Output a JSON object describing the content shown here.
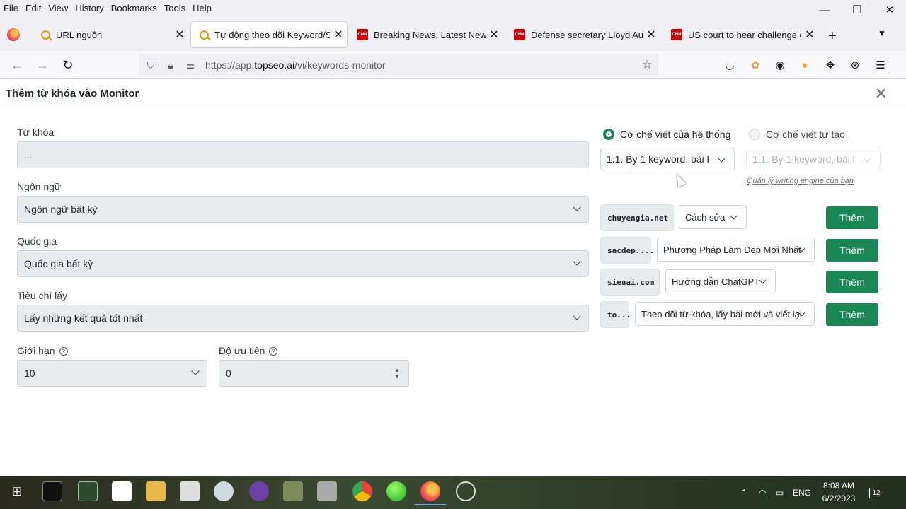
{
  "menu": [
    "File",
    "Edit",
    "View",
    "History",
    "Bookmarks",
    "Tools",
    "Help"
  ],
  "window_controls": {
    "minimize": "—",
    "maximize": "❐",
    "close": "✕"
  },
  "tabs": [
    {
      "title": "URL nguồn",
      "favicon": "search-icon"
    },
    {
      "title": "Tự động theo dõi Keyword/Site",
      "favicon": "search-icon"
    },
    {
      "title": "Breaking News, Latest News and",
      "favicon": "cnn-icon"
    },
    {
      "title": "Defense secretary Lloyd Austin",
      "favicon": "cnn-icon"
    },
    {
      "title": "US court to hear challenge over",
      "favicon": "cnn-icon"
    }
  ],
  "cnn_label": "CNN",
  "newtab": "+",
  "tab_close": "✕",
  "address": {
    "prefix": "https://app.",
    "domain": "topseo.ai",
    "path": "/vi/keywords-monitor"
  },
  "modal": {
    "title": "Thêm từ khóa vào Monitor",
    "close": "✕",
    "keyword_label": "Từ khóa",
    "keyword_placeholder": "...",
    "language_label": "Ngôn ngữ",
    "language_value": "Ngôn ngữ bất kỳ",
    "country_label": "Quốc gia",
    "country_value": "Quốc gia bất kỳ",
    "criteria_label": "Tiêu chí lấy",
    "criteria_value": "Lấy những kết quả tốt nhất",
    "limit_label": "Giới hạn",
    "limit_value": "10",
    "priority_label": "Độ ưu tiên",
    "priority_value": "0",
    "help_glyph": "?"
  },
  "engine": {
    "system_label": "Cơ chế viết của hệ thống",
    "system_value": "1.1. By 1 keyword, bài l",
    "custom_label": "Cơ chế viết tự tạo",
    "custom_value": "1.1. By 1 keyword, bài l",
    "manage_link": "Quản lý writing engine của bạn"
  },
  "sites": [
    {
      "domain": "chuyengia.net",
      "category": "Cách sửa",
      "button": "Thêm"
    },
    {
      "domain": "sacdep....",
      "category": "Phương Pháp Làm Đẹp Mới Nhất",
      "button": "Thêm"
    },
    {
      "domain": "sieuai.com",
      "category": "Hướng dẫn ChatGPT",
      "button": "Thêm"
    },
    {
      "domain": "to...",
      "category": "Theo dõi từ khóa, lấy bài mới và viết lại",
      "button": "Thêm"
    }
  ],
  "taskbar": {
    "language": "ENG",
    "time": "8:08 AM",
    "date": "6/2/2023",
    "notifications": "12"
  },
  "colors": {
    "accent": "#198754",
    "tab_bg": "#f0f0f4",
    "field_bg": "#e9ecef"
  }
}
